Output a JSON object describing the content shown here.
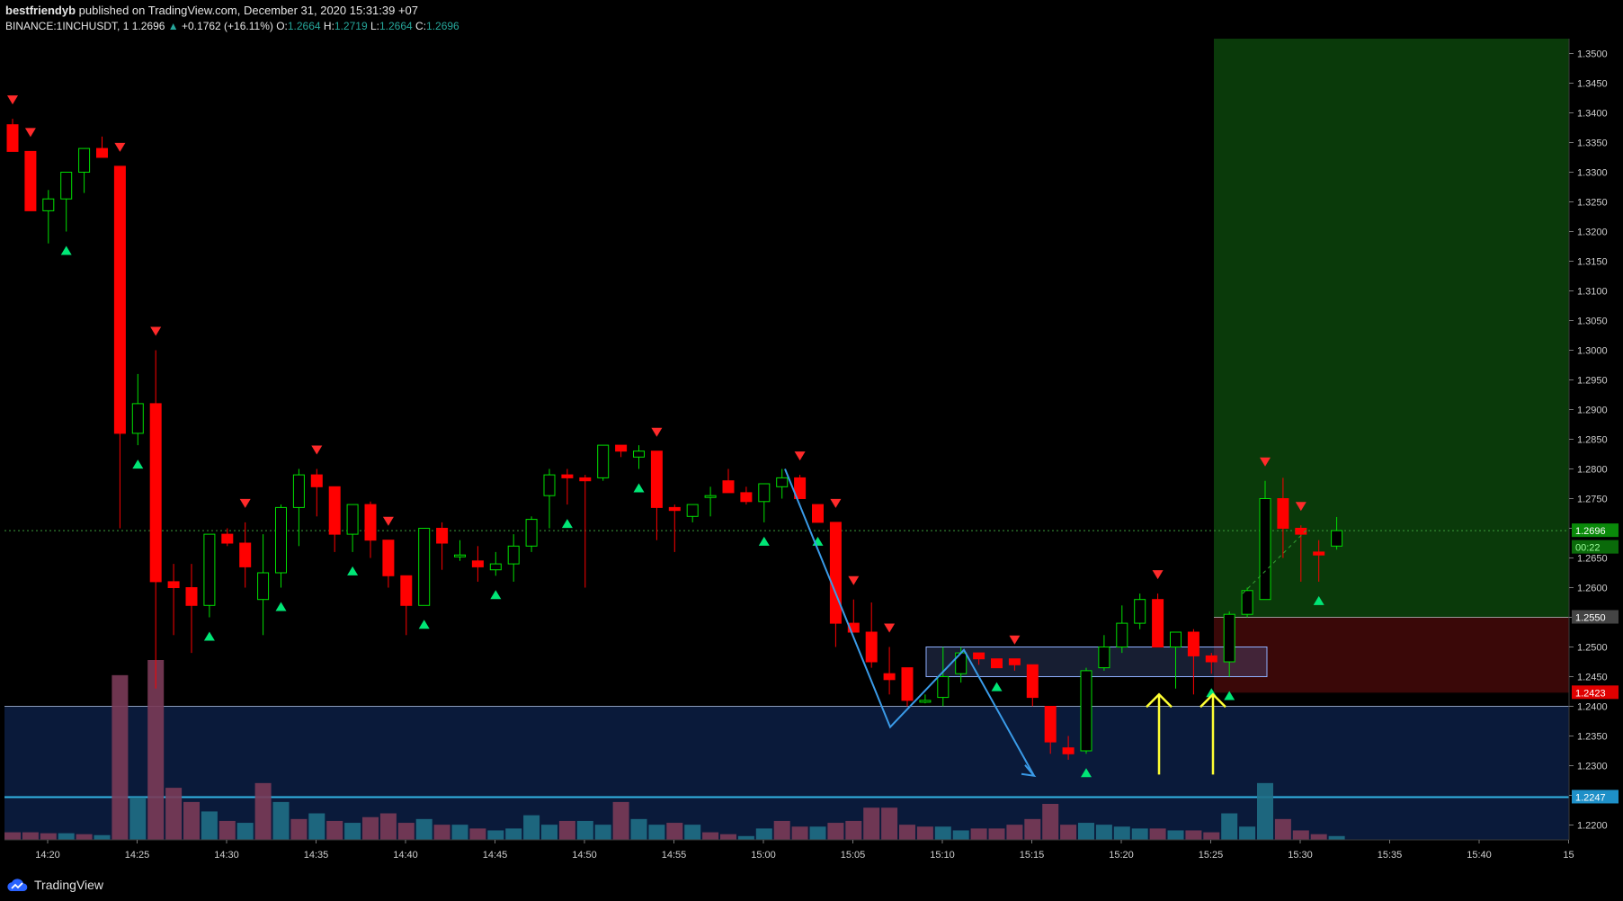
{
  "header": {
    "author": "bestfriendyb",
    "published": "published on TradingView.com, December 31, 2020 15:31:39 +07",
    "symbol": "BINANCE:1INCHUSDT, 1",
    "last": "1.2696",
    "change": "+0.1762 (+16.11%)",
    "o_label": "O:",
    "o": "1.2664",
    "h_label": "H:",
    "h": "1.2719",
    "l_label": "L:",
    "l": "1.2664",
    "c_label": "C:",
    "c": "1.2696"
  },
  "footer": {
    "brand": "TradingView"
  },
  "colors": {
    "up": "#00e000",
    "down": "#ff0000",
    "bg": "#000000",
    "zone": "#0a1a3a",
    "target": "#0a3a0a",
    "stop": "#3a0808",
    "arrow": "#ffff33",
    "pattern": "#3a9be8",
    "vol_up": "#1f6f86",
    "vol_down": "#7a3b58"
  },
  "chart_data": {
    "type": "candlestick",
    "ylim": [
      1.2175,
      1.3525
    ],
    "x_ticks": [
      "14:20",
      "14:25",
      "14:30",
      "14:35",
      "14:40",
      "14:45",
      "14:50",
      "14:55",
      "15:00",
      "15:05",
      "15:10",
      "15:15",
      "15:20",
      "15:25",
      "15:30",
      "15:35",
      "15:40",
      "15"
    ],
    "y_ticks": [
      "1.3500",
      "1.3450",
      "1.3400",
      "1.3350",
      "1.3300",
      "1.3250",
      "1.3200",
      "1.3150",
      "1.3100",
      "1.3050",
      "1.3000",
      "1.2950",
      "1.2900",
      "1.2850",
      "1.2800",
      "1.2750",
      "1.2700",
      "1.2650",
      "1.2600",
      "1.2550",
      "1.2500",
      "1.2450",
      "1.2400",
      "1.2350",
      "1.2300",
      "1.2250",
      "1.2200"
    ],
    "price_labels": {
      "last": "1.2696",
      "countdown": "00:22",
      "entry": "1.2550",
      "stop": "1.2423",
      "support": "1.2247"
    },
    "candles": [
      [
        1.338,
        1.339,
        1.3335,
        1.3335
      ],
      [
        1.3335,
        1.3335,
        1.3235,
        1.3235
      ],
      [
        1.3235,
        1.327,
        1.318,
        1.3255
      ],
      [
        1.3255,
        1.33,
        1.32,
        1.33
      ],
      [
        1.33,
        1.334,
        1.3265,
        1.334
      ],
      [
        1.334,
        1.336,
        1.3325,
        1.3325
      ],
      [
        1.331,
        1.331,
        1.27,
        1.286
      ],
      [
        1.286,
        1.296,
        1.284,
        1.291
      ],
      [
        1.291,
        1.3,
        1.243,
        1.261
      ],
      [
        1.261,
        1.264,
        1.252,
        1.26
      ],
      [
        1.26,
        1.264,
        1.249,
        1.257
      ],
      [
        1.257,
        1.269,
        1.255,
        1.269
      ],
      [
        1.269,
        1.27,
        1.267,
        1.2675
      ],
      [
        1.2675,
        1.271,
        1.26,
        1.2635
      ],
      [
        1.258,
        1.269,
        1.252,
        1.2625
      ],
      [
        1.2625,
        1.274,
        1.26,
        1.2735
      ],
      [
        1.2735,
        1.28,
        1.267,
        1.279
      ],
      [
        1.279,
        1.28,
        1.272,
        1.277
      ],
      [
        1.277,
        1.277,
        1.266,
        1.269
      ],
      [
        1.269,
        1.274,
        1.266,
        1.274
      ],
      [
        1.274,
        1.2745,
        1.265,
        1.268
      ],
      [
        1.268,
        1.268,
        1.26,
        1.262
      ],
      [
        1.262,
        1.262,
        1.252,
        1.257
      ],
      [
        1.257,
        1.27,
        1.257,
        1.27
      ],
      [
        1.27,
        1.271,
        1.263,
        1.2675
      ],
      [
        1.2655,
        1.268,
        1.2645,
        1.2655
      ],
      [
        1.2645,
        1.267,
        1.261,
        1.2635
      ],
      [
        1.263,
        1.266,
        1.262,
        1.264
      ],
      [
        1.264,
        1.269,
        1.261,
        1.267
      ],
      [
        1.267,
        1.272,
        1.266,
        1.2715
      ],
      [
        1.2755,
        1.28,
        1.27,
        1.279
      ],
      [
        1.279,
        1.28,
        1.274,
        1.2785
      ],
      [
        1.2785,
        1.279,
        1.26,
        1.278
      ],
      [
        1.2785,
        1.281,
        1.278,
        1.284
      ],
      [
        1.284,
        1.284,
        1.282,
        1.283
      ],
      [
        1.282,
        1.284,
        1.28,
        1.283
      ],
      [
        1.283,
        1.283,
        1.268,
        1.2735
      ],
      [
        1.2735,
        1.274,
        1.266,
        1.273
      ],
      [
        1.272,
        1.274,
        1.271,
        1.274
      ],
      [
        1.2755,
        1.277,
        1.272,
        1.2755
      ],
      [
        1.278,
        1.28,
        1.276,
        1.276
      ],
      [
        1.276,
        1.277,
        1.274,
        1.2745
      ],
      [
        1.2745,
        1.277,
        1.271,
        1.2775
      ],
      [
        1.277,
        1.28,
        1.275,
        1.2785
      ],
      [
        1.2785,
        1.279,
        1.275,
        1.275
      ],
      [
        1.274,
        1.274,
        1.271,
        1.271
      ],
      [
        1.271,
        1.271,
        1.25,
        1.254
      ],
      [
        1.254,
        1.258,
        1.253,
        1.2525
      ],
      [
        1.2525,
        1.2575,
        1.2465,
        1.2475
      ],
      [
        1.2455,
        1.25,
        1.242,
        1.2445
      ],
      [
        1.2465,
        1.2465,
        1.24,
        1.241
      ],
      [
        1.241,
        1.242,
        1.2405,
        1.241
      ],
      [
        1.2415,
        1.25,
        1.24,
        1.245
      ],
      [
        1.2455,
        1.25,
        1.244,
        1.249
      ],
      [
        1.249,
        1.249,
        1.247,
        1.248
      ],
      [
        1.248,
        1.248,
        1.2465,
        1.2465
      ],
      [
        1.248,
        1.248,
        1.246,
        1.247
      ],
      [
        1.247,
        1.247,
        1.24,
        1.2415
      ],
      [
        1.24,
        1.24,
        1.232,
        1.234
      ],
      [
        1.233,
        1.235,
        1.231,
        1.232
      ],
      [
        1.2325,
        1.2465,
        1.232,
        1.246
      ],
      [
        1.2465,
        1.252,
        1.246,
        1.25
      ],
      [
        1.25,
        1.257,
        1.249,
        1.254
      ],
      [
        1.254,
        1.259,
        1.253,
        1.258
      ],
      [
        1.258,
        1.259,
        1.25,
        1.25
      ],
      [
        1.25,
        1.2525,
        1.243,
        1.2525
      ],
      [
        1.2525,
        1.253,
        1.242,
        1.2485
      ],
      [
        1.2485,
        1.249,
        1.2455,
        1.2475
      ],
      [
        1.2475,
        1.256,
        1.245,
        1.2555
      ],
      [
        1.2555,
        1.26,
        1.255,
        1.2595
      ],
      [
        1.258,
        1.278,
        1.258,
        1.275
      ],
      [
        1.275,
        1.2785,
        1.265,
        1.27
      ],
      [
        1.27,
        1.2705,
        1.261,
        1.269
      ],
      [
        1.266,
        1.268,
        1.261,
        1.2655
      ],
      [
        1.267,
        1.2719,
        1.2664,
        1.2696
      ]
    ],
    "volume": [
      [
        8,
        0
      ],
      [
        8,
        0
      ],
      [
        7,
        0
      ],
      [
        7,
        1
      ],
      [
        6,
        0
      ],
      [
        5,
        1
      ],
      [
        174,
        0
      ],
      [
        45,
        1
      ],
      [
        190,
        0
      ],
      [
        55,
        0
      ],
      [
        40,
        0
      ],
      [
        30,
        1
      ],
      [
        20,
        0
      ],
      [
        18,
        1
      ],
      [
        60,
        0
      ],
      [
        40,
        1
      ],
      [
        22,
        0
      ],
      [
        28,
        1
      ],
      [
        20,
        0
      ],
      [
        18,
        1
      ],
      [
        24,
        0
      ],
      [
        28,
        0
      ],
      [
        18,
        0
      ],
      [
        22,
        1
      ],
      [
        16,
        0
      ],
      [
        16,
        1
      ],
      [
        12,
        0
      ],
      [
        10,
        1
      ],
      [
        12,
        1
      ],
      [
        26,
        1
      ],
      [
        16,
        1
      ],
      [
        20,
        0
      ],
      [
        20,
        1
      ],
      [
        16,
        1
      ],
      [
        40,
        0
      ],
      [
        22,
        1
      ],
      [
        16,
        1
      ],
      [
        18,
        0
      ],
      [
        16,
        1
      ],
      [
        8,
        0
      ],
      [
        6,
        0
      ],
      [
        4,
        1
      ],
      [
        12,
        1
      ],
      [
        20,
        0
      ],
      [
        14,
        0
      ],
      [
        14,
        1
      ],
      [
        18,
        0
      ],
      [
        20,
        0
      ],
      [
        34,
        0
      ],
      [
        34,
        0
      ],
      [
        16,
        0
      ],
      [
        14,
        0
      ],
      [
        14,
        1
      ],
      [
        10,
        1
      ],
      [
        12,
        0
      ],
      [
        12,
        0
      ],
      [
        16,
        0
      ],
      [
        22,
        0
      ],
      [
        38,
        0
      ],
      [
        16,
        0
      ],
      [
        18,
        1
      ],
      [
        16,
        1
      ],
      [
        14,
        1
      ],
      [
        12,
        1
      ],
      [
        12,
        0
      ],
      [
        10,
        1
      ],
      [
        10,
        0
      ],
      [
        8,
        0
      ],
      [
        28,
        1
      ],
      [
        14,
        1
      ],
      [
        60,
        1
      ],
      [
        22,
        0
      ],
      [
        10,
        0
      ],
      [
        6,
        0
      ],
      [
        4,
        1
      ]
    ],
    "signals_up": [
      3,
      7,
      11,
      15,
      19,
      23,
      27,
      31,
      35,
      42,
      45,
      55,
      60,
      67,
      68,
      73
    ],
    "signals_down": [
      0,
      1,
      6,
      8,
      13,
      17,
      21,
      36,
      44,
      46,
      47,
      49,
      56,
      64,
      70,
      72
    ]
  }
}
